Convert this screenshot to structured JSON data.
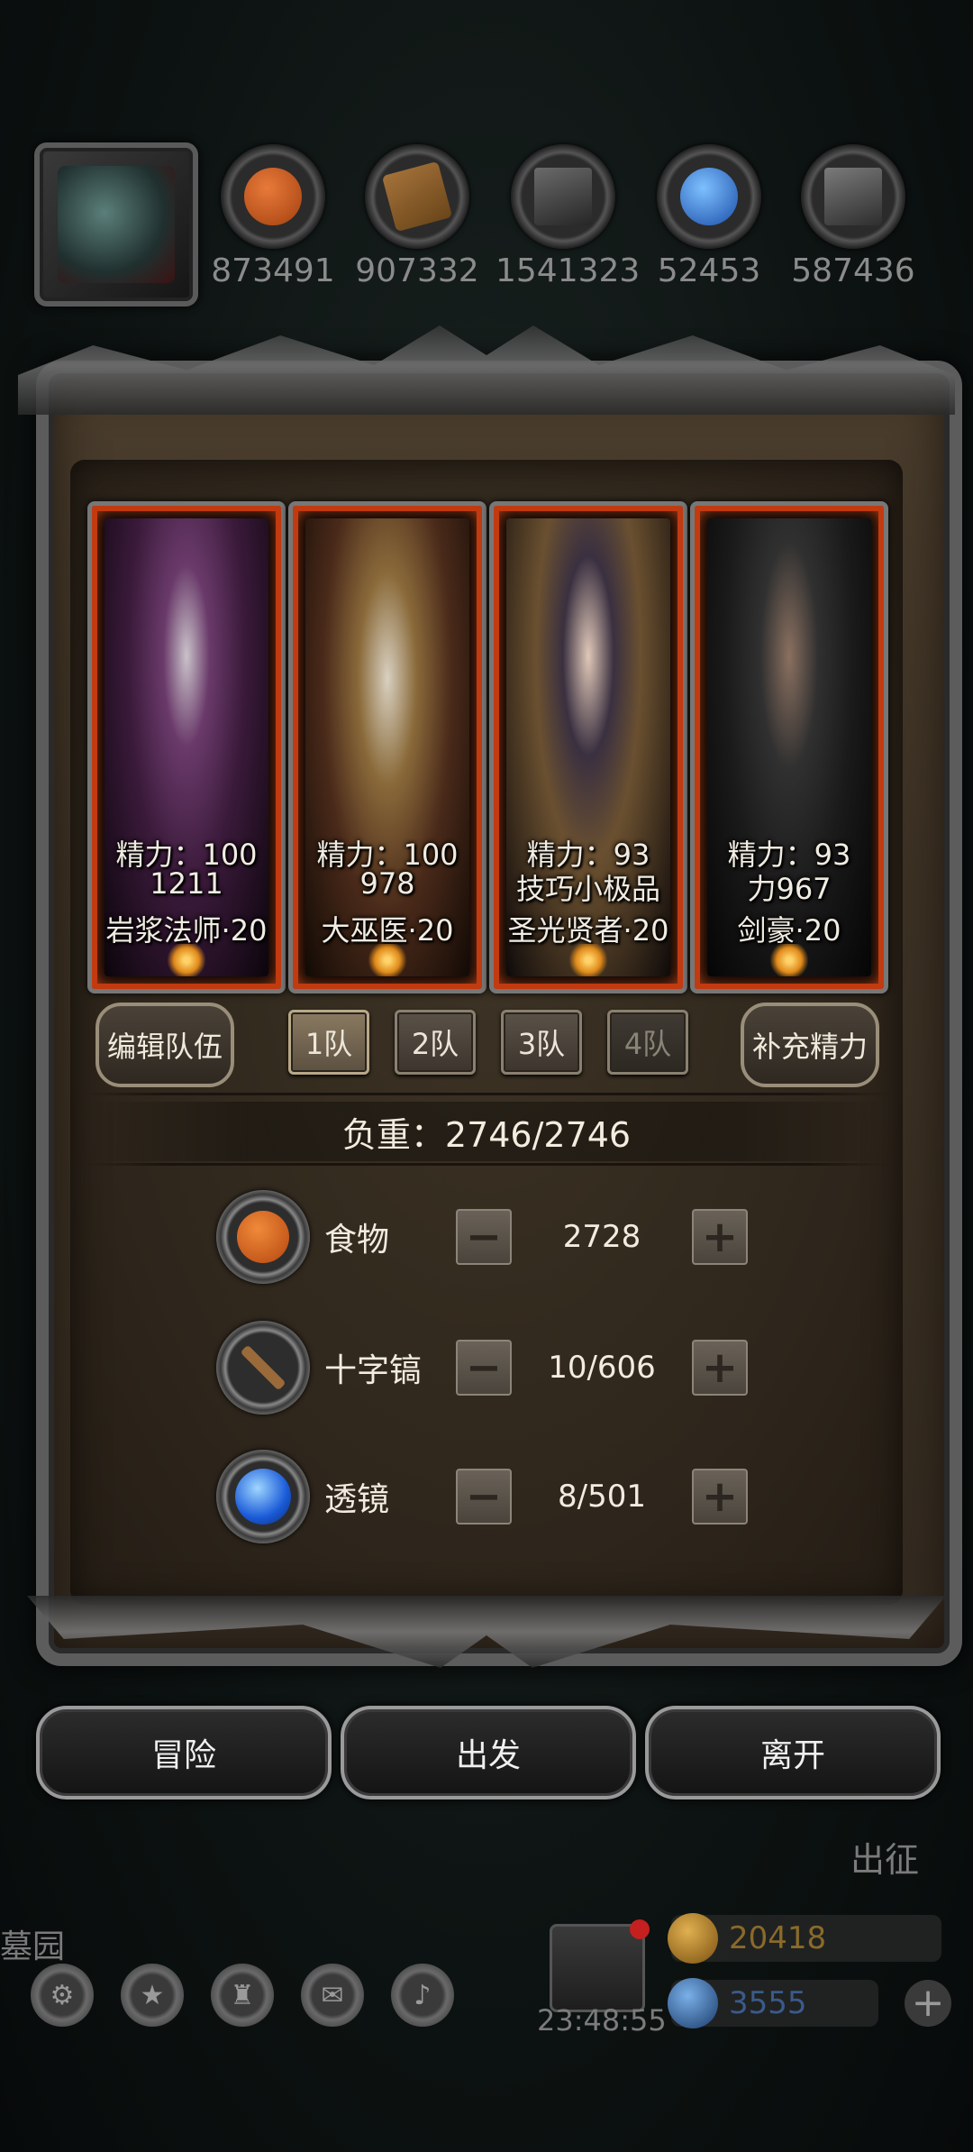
{
  "resources": [
    {
      "name": "food-icon",
      "value": "873491",
      "color": "#c9551e"
    },
    {
      "name": "wood-icon",
      "value": "907332",
      "color": "#8a5a2a"
    },
    {
      "name": "iron-icon",
      "value": "1541323",
      "color": "#555555"
    },
    {
      "name": "crystal-icon",
      "value": "52453",
      "color": "#3a7ad8"
    },
    {
      "name": "stone-icon",
      "value": "587436",
      "color": "#6a6a6a"
    }
  ],
  "heroes": [
    {
      "stamina": "精力：100",
      "power": "1211",
      "name": "岩浆法师·20",
      "art": [
        "#5a2b5a",
        "#1a0a1a"
      ]
    },
    {
      "stamina": "精力：100",
      "power": "978",
      "name": "大巫医·20",
      "art": [
        "#7a5a2a",
        "#2a1a0a"
      ]
    },
    {
      "stamina": "精力：93",
      "power": "技巧小极品",
      "name": "圣光贤者·20",
      "art": [
        "#4a3a3a",
        "#120d0d"
      ]
    },
    {
      "stamina": "精力：93",
      "power": "力967",
      "name": "剑豪·20",
      "art": [
        "#2f2f2f",
        "#0c0c0c"
      ]
    }
  ],
  "team_controls": {
    "edit_team": "编辑队伍",
    "teams": [
      "1队",
      "2队",
      "3队",
      "4队"
    ],
    "active_team": "1队",
    "refill": "补充精力"
  },
  "load": "负重：2746/2746",
  "supplies": [
    {
      "label": "食物",
      "value": "2728",
      "icon": "food-icon",
      "color": "#d9621e"
    },
    {
      "label": "十字镐",
      "value": "10/606",
      "icon": "pickaxe-icon",
      "color": "#8a5a2a"
    },
    {
      "label": "透镜",
      "value": "8/501",
      "icon": "lens-icon",
      "color": "#2a7ae8"
    }
  ],
  "stepper": {
    "minus": "−",
    "plus": "+"
  },
  "actions": {
    "adventure": "冒险",
    "depart": "出发",
    "leave": "离开"
  },
  "background": {
    "expedition": "出征",
    "garden": "墓园",
    "timer": "23:48:55",
    "gold": "20418",
    "gems": "3555"
  }
}
